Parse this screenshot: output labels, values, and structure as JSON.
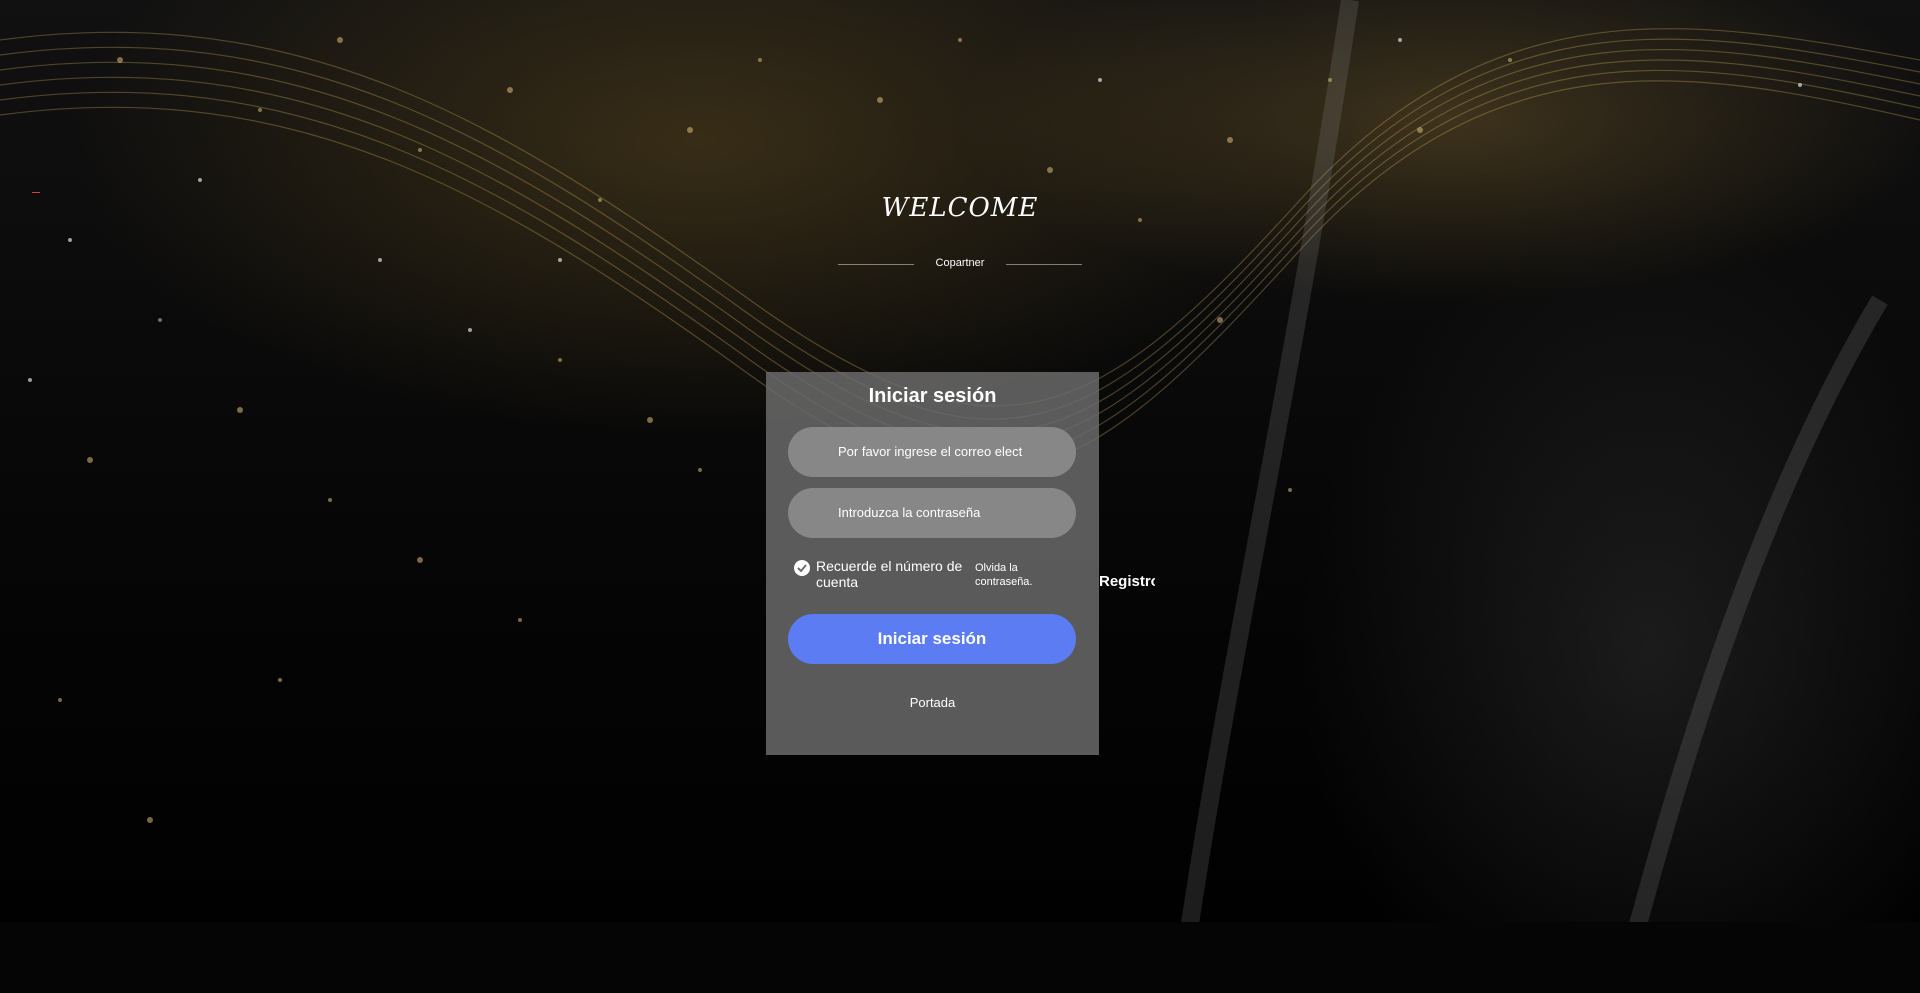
{
  "header": {
    "welcome": "WELCOME",
    "brand": "Copartner"
  },
  "login": {
    "title": "Iniciar sesión",
    "email_placeholder": "Por favor ingrese el correo electrónico",
    "password_placeholder": "Introduzca la contraseña",
    "remember_label": "Recuerde el número de cuenta",
    "remember_checked": true,
    "forgot_label": "Olvida la contraseña.",
    "register_label": "Registro",
    "submit_label": "Iniciar sesión",
    "home_label": "Portada"
  },
  "colors": {
    "submit_button": "#5b7cf2",
    "card_background": "#6e6e6e"
  }
}
